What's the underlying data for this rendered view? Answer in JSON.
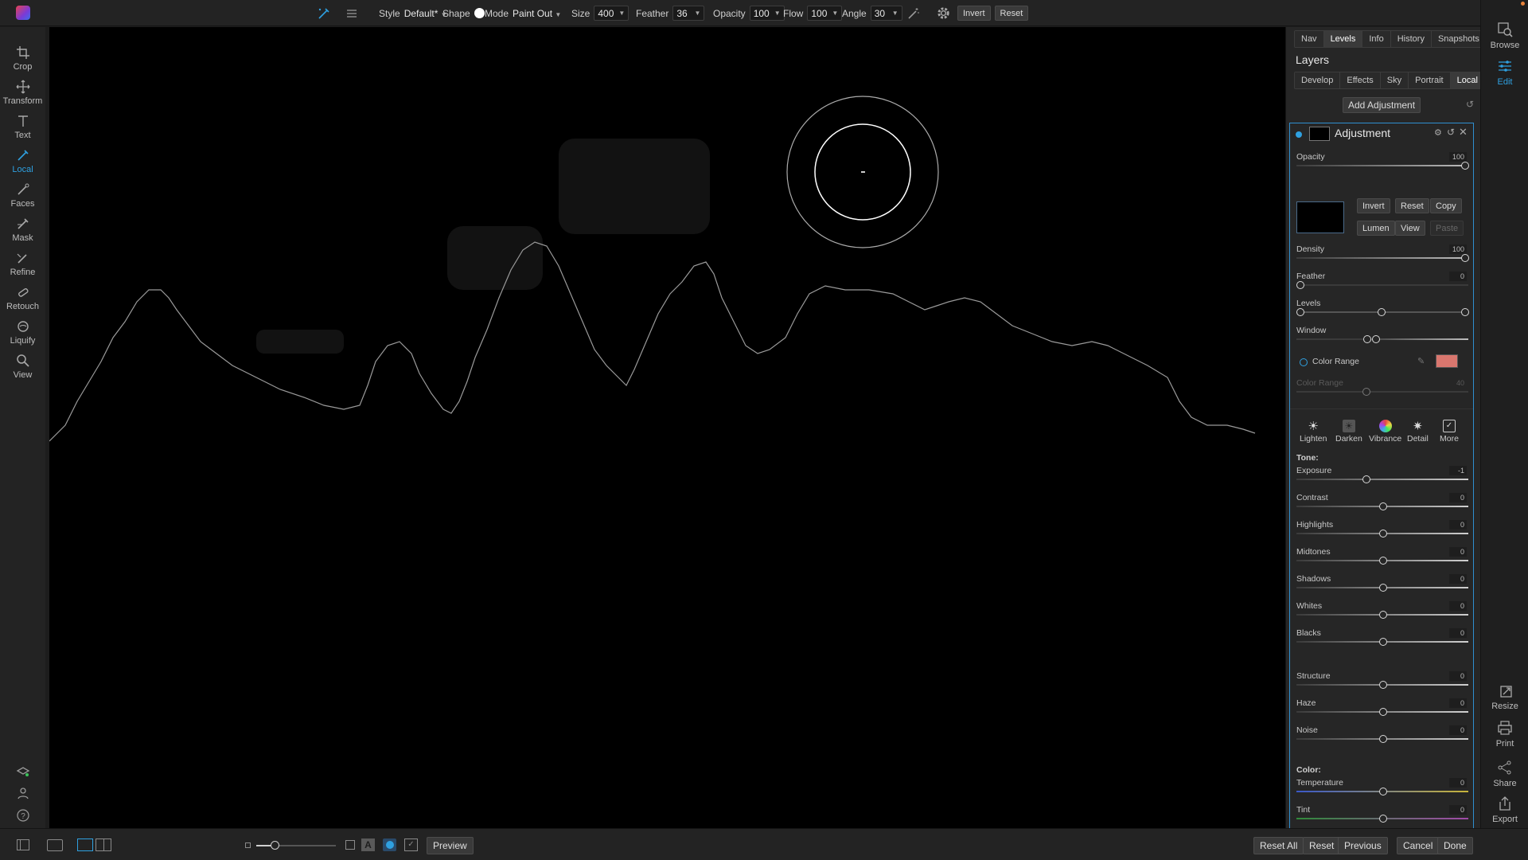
{
  "toolbar": {
    "style_label": "Style",
    "style_value": "Default*",
    "shape_label": "Shape",
    "mode_label": "Mode",
    "mode_value": "Paint Out",
    "size_label": "Size",
    "size_value": "400",
    "feather_label": "Feather",
    "feather_value": "36",
    "opacity_label": "Opacity",
    "opacity_value": "100",
    "flow_label": "Flow",
    "flow_value": "100",
    "angle_label": "Angle",
    "angle_value": "30",
    "invert_label": "Invert",
    "reset_label": "Reset"
  },
  "left_tools": [
    {
      "label": "Crop",
      "icon": "crop-icon"
    },
    {
      "label": "Transform",
      "icon": "move-icon"
    },
    {
      "label": "Text",
      "icon": "text-icon"
    },
    {
      "label": "Local",
      "icon": "brush-icon",
      "active": true
    },
    {
      "label": "Faces",
      "icon": "faces-icon"
    },
    {
      "label": "Mask",
      "icon": "mask-brush-icon"
    },
    {
      "label": "Refine",
      "icon": "refine-brush-icon"
    },
    {
      "label": "Retouch",
      "icon": "bandage-icon"
    },
    {
      "label": "Liquify",
      "icon": "liquify-icon"
    },
    {
      "label": "View",
      "icon": "magnifier-icon"
    }
  ],
  "panel": {
    "top_tabs": [
      "Nav",
      "Levels",
      "Info",
      "History",
      "Snapshots"
    ],
    "top_tab_active": "Levels",
    "layers_title": "Layers",
    "module_tabs": [
      "Develop",
      "Effects",
      "Sky",
      "Portrait",
      "Local"
    ],
    "module_tab_active": "Local",
    "add_adjustment": "Add Adjustment",
    "adjustment_title": "Adjustment",
    "opacity": {
      "label": "Opacity",
      "value": "100",
      "pos": 1.0
    },
    "mask_buttons": {
      "invert": "Invert",
      "reset": "Reset",
      "copy": "Copy",
      "lumen": "Lumen",
      "view": "View",
      "paste": "Paste"
    },
    "density": {
      "label": "Density",
      "value": "100",
      "pos": 1.0
    },
    "feather": {
      "label": "Feather",
      "value": "0",
      "pos": 0.0
    },
    "levels_label": "Levels",
    "window_label": "Window",
    "color_range_label": "Color Range",
    "color_range_slider": {
      "label": "Color Range",
      "value": "40",
      "pos": 0.4
    },
    "swatch_color": "#d9766e",
    "presets": [
      {
        "label": "Lighten",
        "icon": "sun-icon"
      },
      {
        "label": "Darken",
        "icon": "darken-icon"
      },
      {
        "label": "Vibrance",
        "icon": "vibrance-icon"
      },
      {
        "label": "Detail",
        "icon": "detail-icon"
      },
      {
        "label": "More",
        "icon": "more-icon"
      }
    ],
    "tone_heading": "Tone:",
    "tone_sliders": [
      {
        "label": "Exposure",
        "value": "-1",
        "pos": 0.4
      },
      {
        "label": "Contrast",
        "value": "0",
        "pos": 0.5
      },
      {
        "label": "Highlights",
        "value": "0",
        "pos": 0.5
      },
      {
        "label": "Midtones",
        "value": "0",
        "pos": 0.5
      },
      {
        "label": "Shadows",
        "value": "0",
        "pos": 0.5
      },
      {
        "label": "Whites",
        "value": "0",
        "pos": 0.5
      },
      {
        "label": "Blacks",
        "value": "0",
        "pos": 0.5
      }
    ],
    "detail_sliders": [
      {
        "label": "Structure",
        "value": "0",
        "pos": 0.5
      },
      {
        "label": "Haze",
        "value": "0",
        "pos": 0.5
      },
      {
        "label": "Noise",
        "value": "0",
        "pos": 0.5
      }
    ],
    "color_heading": "Color:",
    "color_sliders": [
      {
        "label": "Temperature",
        "value": "0",
        "pos": 0.5
      },
      {
        "label": "Tint",
        "value": "0",
        "pos": 0.5
      }
    ]
  },
  "right_bar": [
    {
      "label": "Browse",
      "icon": "browse-icon"
    },
    {
      "label": "Edit",
      "icon": "sliders-icon",
      "active": true
    },
    {
      "label": "Resize",
      "icon": "resize-icon"
    },
    {
      "label": "Print",
      "icon": "printer-icon"
    },
    {
      "label": "Share",
      "icon": "share-icon"
    },
    {
      "label": "Export",
      "icon": "export-icon"
    }
  ],
  "bottom": {
    "preview": "Preview",
    "reset_all": "Reset All",
    "reset": "Reset",
    "previous": "Previous",
    "cancel": "Cancel",
    "done": "Done"
  },
  "colors": {
    "accent": "#2fa0e0",
    "panel_border": "#2f8fd0",
    "canvas": "#000000"
  }
}
